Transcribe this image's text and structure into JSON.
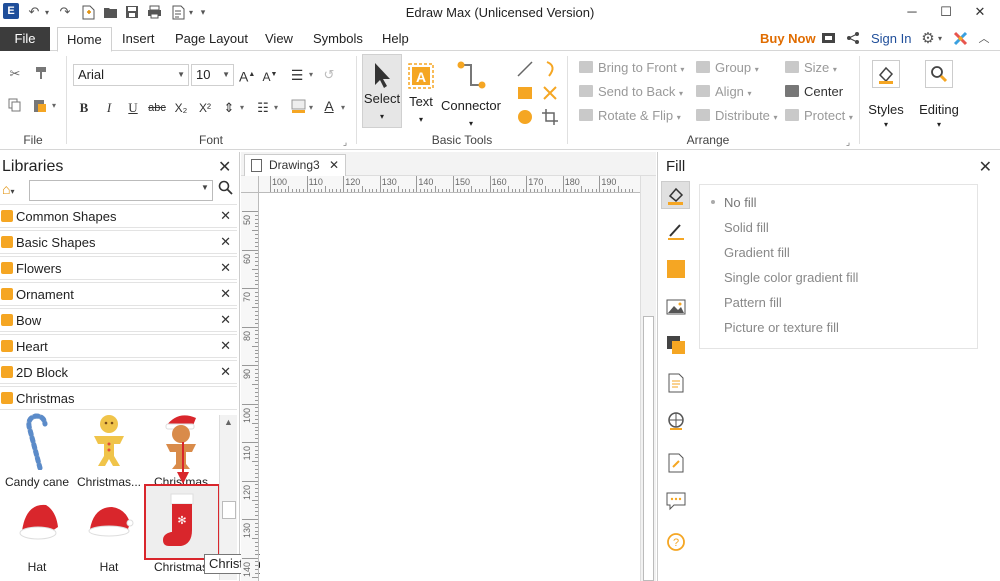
{
  "window": {
    "title": "Edraw Max (Unlicensed Version)",
    "logo_letter": "E",
    "minimize": "─",
    "maximize": "☐",
    "close": "✕"
  },
  "menu": {
    "file": "File",
    "tabs": [
      "Home",
      "Insert",
      "Page Layout",
      "View",
      "Symbols",
      "Help"
    ],
    "buy_now": "Buy Now",
    "sign_in": "Sign In"
  },
  "ribbon": {
    "groups": {
      "file": "File",
      "font": "Font",
      "basic_tools": "Basic Tools",
      "arrange": "Arrange"
    },
    "font_name": "Arial",
    "font_size": "10",
    "select_label": "Select",
    "text_label": "Text",
    "connector_label": "Connector",
    "styles_label": "Styles",
    "editing_label": "Editing",
    "arrange_items": {
      "bring_to_front": "Bring to Front",
      "send_to_back": "Send to Back",
      "rotate_flip": "Rotate & Flip",
      "group": "Group",
      "align": "Align",
      "distribute": "Distribute",
      "size": "Size",
      "center": "Center",
      "protect": "Protect"
    },
    "font_buttons": {
      "bold": "B",
      "italic": "I",
      "underline": "U",
      "strike": "abc",
      "subscript": "X₂",
      "superscript": "X²",
      "font_color": "A"
    }
  },
  "libraries": {
    "title": "Libraries",
    "search_value": "",
    "categories": [
      "Common Shapes",
      "Basic Shapes",
      "Flowers",
      "Ornament",
      "Bow",
      "Heart",
      "2D Block",
      "Christmas"
    ],
    "shapes": [
      "Candy cane",
      "Christmas...",
      "Christmas",
      "Hat",
      "Hat",
      "Christmas"
    ],
    "tooltip": "Christmas Stockings"
  },
  "document": {
    "tab_name": "Drawing3",
    "ruler_top": [
      "100",
      "110",
      "120",
      "130",
      "140",
      "150",
      "160",
      "170",
      "180",
      "190"
    ],
    "ruler_left": [
      "50",
      "60",
      "70",
      "80",
      "90",
      "100",
      "110",
      "120",
      "130",
      "140"
    ]
  },
  "fill_panel": {
    "title": "Fill",
    "options": [
      "No fill",
      "Solid fill",
      "Gradient fill",
      "Single color gradient fill",
      "Pattern fill",
      "Picture or texture fill"
    ],
    "selected": "No fill"
  },
  "colors": {
    "accent_orange": "#f5a623",
    "file_tab_bg": "#3c3c3c",
    "buy_now": "#e06c00",
    "selection_red": "#d9262c"
  }
}
